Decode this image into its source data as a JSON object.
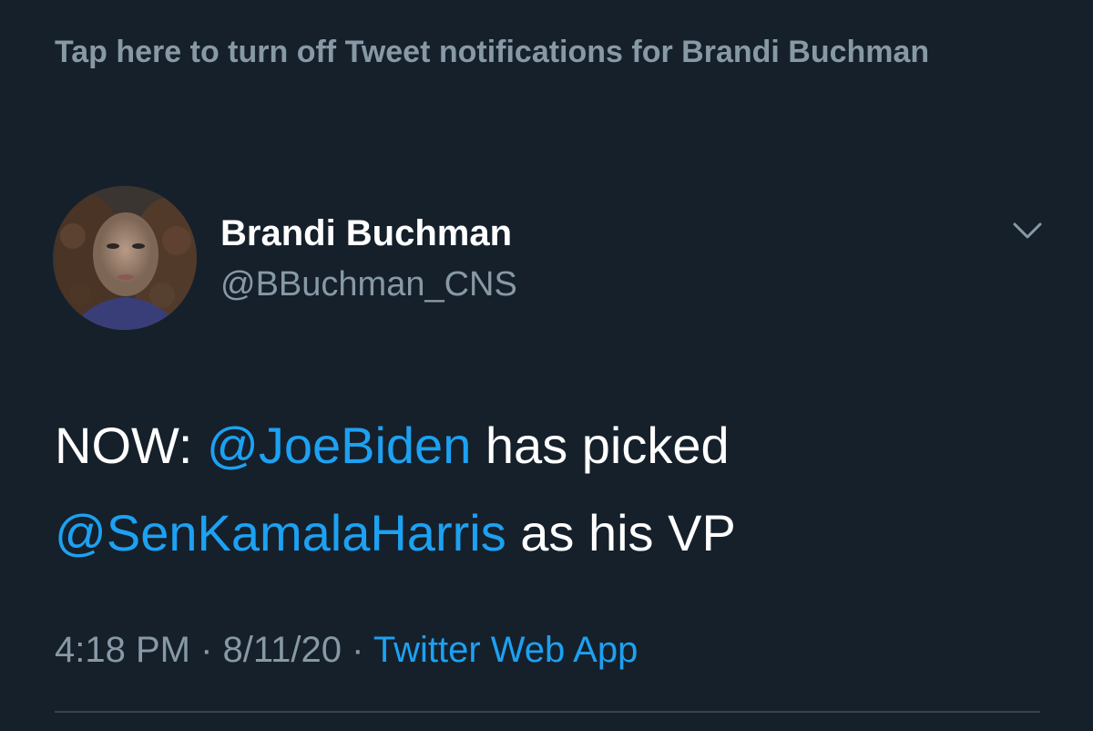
{
  "colors": {
    "background": "#15202b",
    "secondary_text": "#8899a6",
    "primary_text": "#ffffff",
    "link": "#1da1f2",
    "divider": "#38444d"
  },
  "notification_banner": {
    "text": "Tap here to turn off Tweet notifications for Brandi Buchman"
  },
  "tweet": {
    "author": {
      "display_name": "Brandi Buchman",
      "handle": "@BBuchman_CNS",
      "avatar_icon": "profile-photo"
    },
    "menu_icon": "chevron-down-icon",
    "text": {
      "prefix": "NOW: ",
      "mention_1": "@JoeBiden",
      "middle": " has picked ",
      "mention_2": "@SenKamalaHarris",
      "suffix": " as his VP"
    },
    "meta": {
      "time": "4:18 PM",
      "separator_1": " · ",
      "date": "8/11/20",
      "separator_2": " · ",
      "source": "Twitter Web App"
    }
  }
}
